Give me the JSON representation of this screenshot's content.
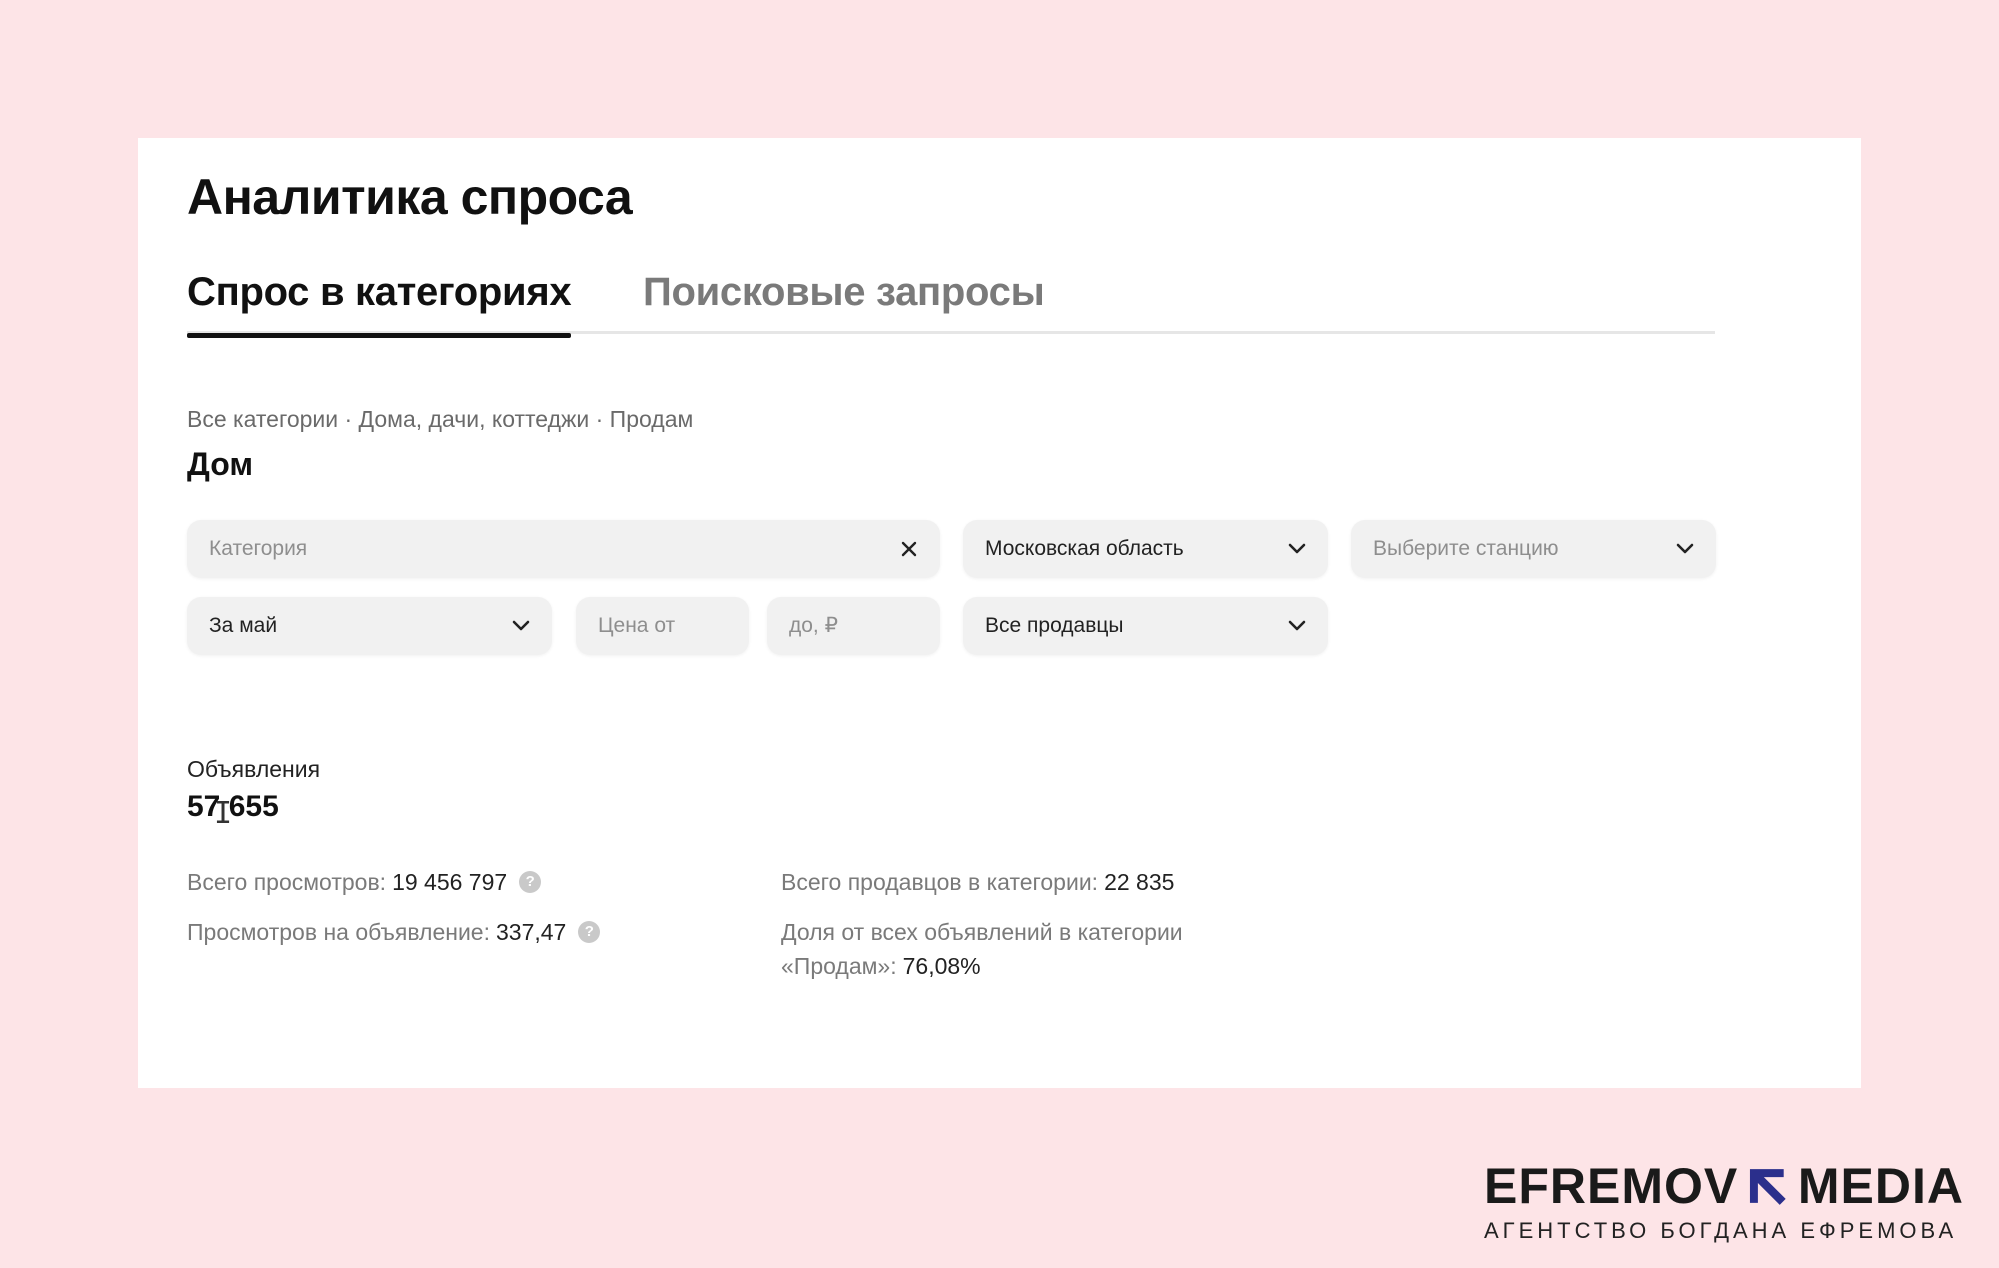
{
  "page": {
    "title": "Аналитика спроса"
  },
  "tabs": [
    {
      "label": "Спрос в категориях",
      "active": true
    },
    {
      "label": "Поисковые запросы",
      "active": false
    }
  ],
  "breadcrumb": "Все категории · Дома, дачи, коттеджи · Продам",
  "section_title": "Дом",
  "filters": {
    "category": {
      "placeholder": "Категория"
    },
    "region": {
      "value": "Московская область"
    },
    "station": {
      "placeholder": "Выберите станцию"
    },
    "period": {
      "value": "За май"
    },
    "price_from": {
      "placeholder": "Цена от"
    },
    "price_to": {
      "placeholder": "до, ₽"
    },
    "sellers": {
      "value": "Все продавцы"
    }
  },
  "ads": {
    "label": "Объявления",
    "count": "57 655"
  },
  "stats": {
    "total_views_label": "Всего просмотров:",
    "total_views_value": "19 456 797",
    "views_per_ad_label": "Просмотров на объявление:",
    "views_per_ad_value": "337,47",
    "total_sellers_label": "Всего продавцов в категории:",
    "total_sellers_value": "22 835",
    "share_label_line1": "Доля от всех объявлений в категории",
    "share_label_line2": "«Продам»:",
    "share_value": "76,08%",
    "help_glyph": "?"
  },
  "brand": {
    "left": "EFREMOV",
    "right": "MEDIA",
    "subtitle": "АГЕНТСТВО БОГДАНА ЕФРЕМОВА",
    "accent_color": "#2b2f8c"
  },
  "colors": {
    "background": "#fde4e7",
    "panel": "#ffffff",
    "field": "#f1f1f1",
    "muted_text": "#7a7a7a"
  }
}
